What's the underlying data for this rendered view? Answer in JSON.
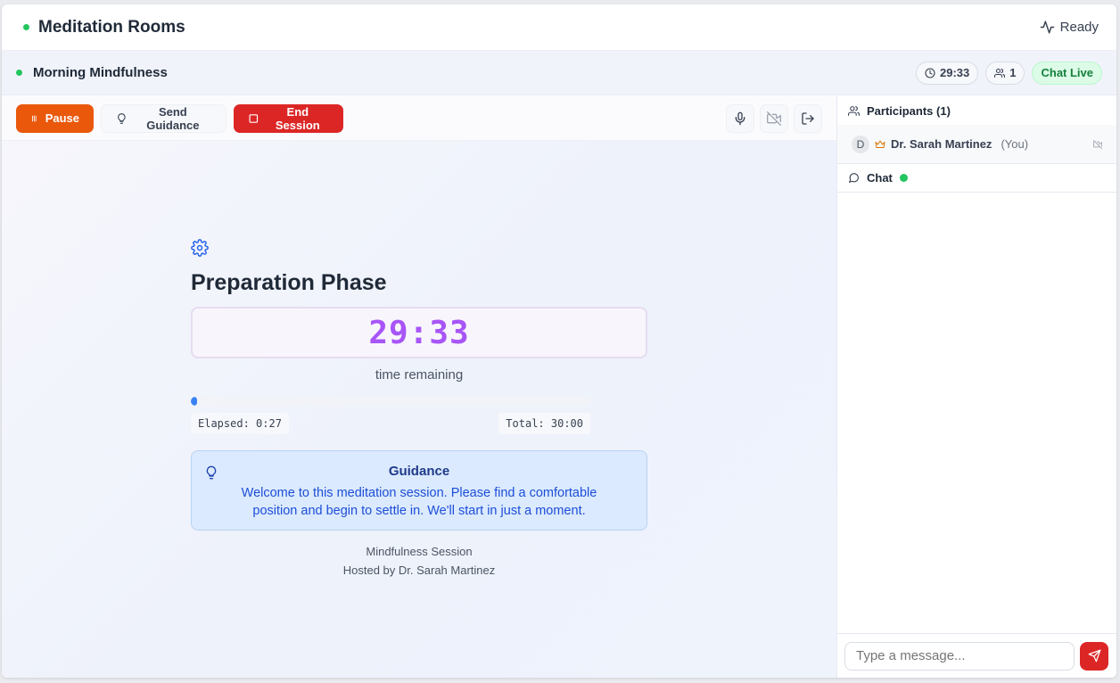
{
  "header": {
    "title": "Meditation Rooms",
    "status_label": "Ready",
    "status_dot_color": "#22c55e"
  },
  "session": {
    "name": "Morning Mindfulness",
    "timer_pill": "29:33",
    "participants_count": "1",
    "chat_status": "Chat Live"
  },
  "toolbar": {
    "pause_label": "Pause",
    "guidance_label": "Send Guidance",
    "end_label": "End Session"
  },
  "main": {
    "phase_title": "Preparation Phase",
    "timer": "29:33",
    "timer_caption": "time remaining",
    "progress_fraction": 0.015,
    "elapsed": "Elapsed: 0:27",
    "total": "Total: 30:00",
    "guidance_title": "Guidance",
    "guidance_text": "Welcome to this meditation session. Please find a comfortable position and begin to settle in. We'll start in just a moment.",
    "session_type": "Mindfulness Session",
    "host_line": "Hosted by Dr. Sarah Martinez"
  },
  "sidebar": {
    "participants_header": "Participants (1)",
    "participant": {
      "initial": "D",
      "name": "Dr. Sarah Martinez",
      "suffix": "(You)"
    },
    "chat_header": "Chat",
    "chat_placeholder": "Type a message..."
  },
  "colors": {
    "pause": "#ea580c",
    "end": "#dc2626",
    "timer": "#a855f7",
    "progress": "#3b82f6",
    "live": "#15803d"
  }
}
